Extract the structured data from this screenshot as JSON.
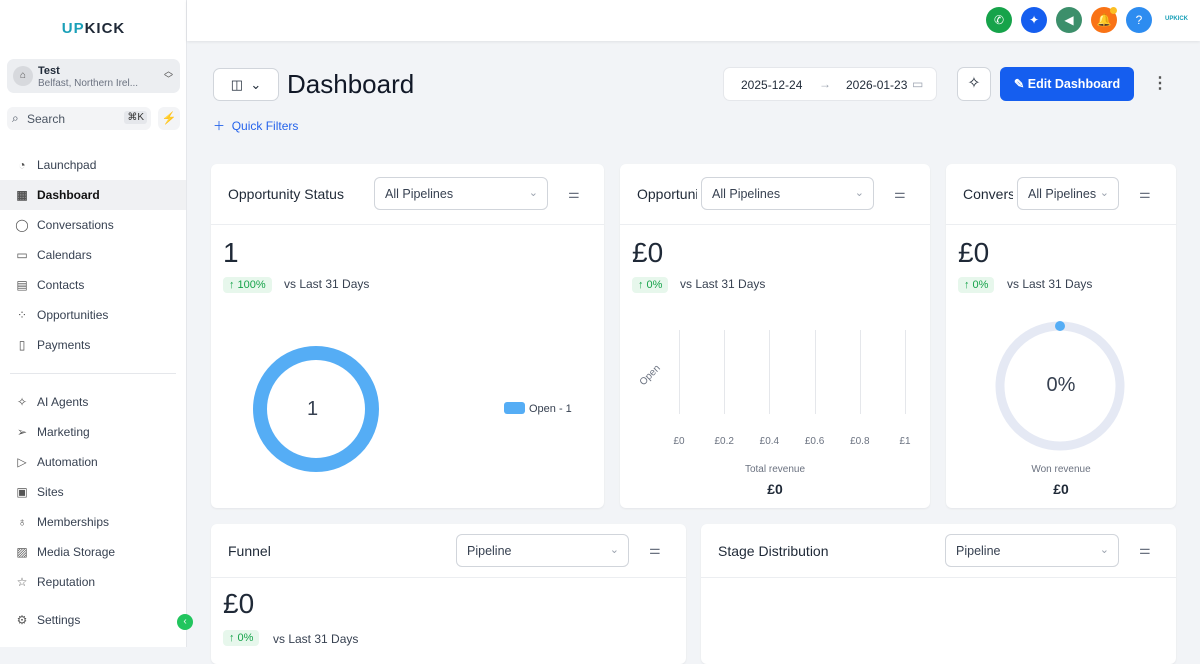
{
  "brand": {
    "logo_up": "UP",
    "logo_kick": "KICK",
    "mini_logo": "UPKICK"
  },
  "account": {
    "name": "Test",
    "location": "Belfast, Northern Irel..."
  },
  "search": {
    "label": "Search",
    "shortcut": "⌘K"
  },
  "nav1": [
    {
      "label": "Launchpad",
      "icon": "◔"
    },
    {
      "label": "Dashboard",
      "icon": "▦"
    },
    {
      "label": "Conversations",
      "icon": "◯"
    },
    {
      "label": "Calendars",
      "icon": "▭"
    },
    {
      "label": "Contacts",
      "icon": "▤"
    },
    {
      "label": "Opportunities",
      "icon": "⁘"
    },
    {
      "label": "Payments",
      "icon": "▯"
    }
  ],
  "nav2": [
    {
      "label": "AI Agents",
      "icon": "✧"
    },
    {
      "label": "Marketing",
      "icon": "➢"
    },
    {
      "label": "Automation",
      "icon": "▷"
    },
    {
      "label": "Sites",
      "icon": "▣"
    },
    {
      "label": "Memberships",
      "icon": "♁"
    },
    {
      "label": "Media Storage",
      "icon": "▨"
    },
    {
      "label": "Reputation",
      "icon": "☆"
    }
  ],
  "settings": {
    "label": "Settings",
    "icon": "⚙"
  },
  "topbar": {
    "icons": [
      {
        "name": "phone",
        "glyph": "✆",
        "color": "#16a34a"
      },
      {
        "name": "ai",
        "glyph": "✦",
        "color": "#155eef"
      },
      {
        "name": "megaphone",
        "glyph": "◀",
        "color": "#3c8f6b"
      },
      {
        "name": "bell",
        "glyph": "🔔",
        "color": "#f97316"
      },
      {
        "name": "help",
        "glyph": "?",
        "color": "#2d8cf0"
      }
    ]
  },
  "header": {
    "title": "Dashboard",
    "quick_filters": "Quick Filters",
    "date_from": "2025-12-24",
    "date_to": "2026-01-23",
    "edit": "Edit Dashboard"
  },
  "cards": {
    "status": {
      "title": "Opportunity Status",
      "select": "All Pipelines",
      "value": "1",
      "change": "↑ 100%",
      "vs": "vs Last 31 Days",
      "center": "1",
      "legend": "Open - 1"
    },
    "value": {
      "title": "Opportunity Value",
      "select": "All Pipelines",
      "value": "£0",
      "change": "↑ 0%",
      "vs": "vs Last 31 Days",
      "footer_label": "Total revenue",
      "footer_value": "£0"
    },
    "conversion": {
      "title": "Conversion Rate",
      "select": "All Pipelines",
      "value": "£0",
      "change": "↑ 0%",
      "vs": "vs Last 31 Days",
      "center": "0%",
      "footer_label": "Won revenue",
      "footer_value": "£0"
    },
    "funnel": {
      "title": "Funnel",
      "select": "Pipeline",
      "value": "£0",
      "change": "↑ 0%",
      "vs": "vs Last 31 Days"
    },
    "stage": {
      "title": "Stage Distribution",
      "select": "Pipeline"
    }
  },
  "chart_data": [
    {
      "type": "pie",
      "title": "Opportunity Status",
      "labels": [
        "Open"
      ],
      "values": [
        1
      ],
      "legend": "right"
    },
    {
      "type": "bar",
      "title": "Opportunity Value",
      "orientation": "horizontal",
      "categories": [
        "Open"
      ],
      "values": [
        0
      ],
      "xlabel": "Total revenue",
      "xticks": [
        "£0",
        "£0.2",
        "£0.4",
        "£0.6",
        "£0.8",
        "£1"
      ],
      "xlim": [
        0,
        1
      ]
    },
    {
      "type": "pie",
      "title": "Conversion Rate",
      "values": [
        0
      ],
      "center_label": "0%"
    }
  ]
}
